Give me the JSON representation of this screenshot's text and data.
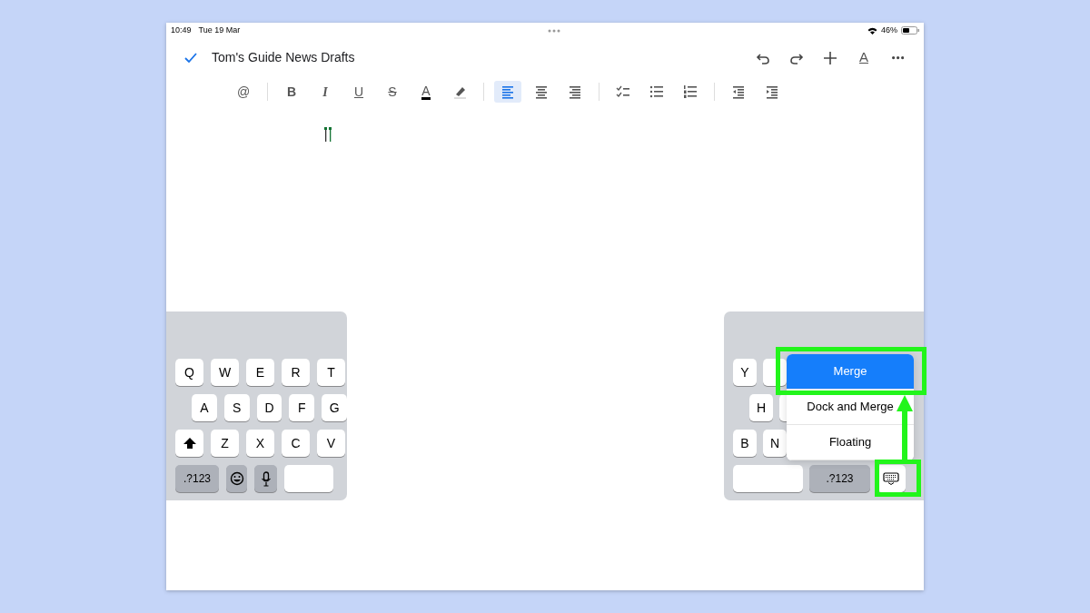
{
  "status_bar": {
    "time": "10:49",
    "date": "Tue 19 Mar",
    "battery": "46%"
  },
  "document": {
    "title": "Tom's Guide News Drafts"
  },
  "top_actions": [
    {
      "kind": "undo"
    },
    {
      "kind": "redo"
    },
    {
      "kind": "insert"
    },
    {
      "kind": "format",
      "glyph": "A"
    },
    {
      "kind": "more"
    }
  ],
  "format_toolbar": {
    "groups": [
      [
        {
          "glyph": "@",
          "selected": false
        }
      ],
      [
        {
          "glyph": "B",
          "selected": false
        },
        {
          "glyph": "I",
          "selected": false
        },
        {
          "glyph": "U",
          "selected": false
        },
        {
          "glyph": "S",
          "selected": false
        },
        {
          "glyph": "A",
          "selected": false
        },
        {
          "selected": false
        }
      ],
      [
        {
          "selected": true
        },
        {
          "selected": false
        },
        {
          "selected": false
        }
      ],
      [
        {
          "selected": false
        },
        {
          "selected": false
        },
        {
          "selected": false
        }
      ],
      [
        {
          "selected": false
        },
        {
          "selected": false
        }
      ]
    ]
  },
  "keyboard_left": {
    "rows": [
      [
        {
          "kind": "letter",
          "label": "Q"
        },
        {
          "kind": "letter",
          "label": "W"
        },
        {
          "kind": "letter",
          "label": "E"
        },
        {
          "kind": "letter",
          "label": "R"
        },
        {
          "kind": "letter",
          "label": "T"
        }
      ],
      [
        {
          "kind": "letter",
          "label": "A"
        },
        {
          "kind": "letter",
          "label": "S"
        },
        {
          "kind": "letter",
          "label": "D"
        },
        {
          "kind": "letter",
          "label": "F"
        },
        {
          "kind": "letter",
          "label": "G"
        }
      ],
      [
        {
          "kind": "shift"
        },
        {
          "kind": "letter",
          "label": "Z"
        },
        {
          "kind": "letter",
          "label": "X"
        },
        {
          "kind": "letter",
          "label": "C"
        },
        {
          "kind": "letter",
          "label": "V"
        }
      ],
      [
        {
          "kind": "mode",
          "label": ".?123"
        },
        {
          "kind": "emoji"
        },
        {
          "kind": "mic"
        },
        {
          "kind": "space"
        }
      ]
    ]
  },
  "keyboard_right": {
    "rows": [
      [
        {
          "kind": "letter",
          "label": "Y"
        },
        {
          "kind": "hidden"
        }
      ],
      [
        {
          "kind": "letter",
          "label": "H"
        },
        {
          "kind": "hidden"
        }
      ],
      [
        {
          "kind": "letter",
          "label": "B"
        },
        {
          "kind": "letter",
          "label": "N"
        }
      ],
      [
        {
          "kind": "space"
        },
        {
          "kind": "mode",
          "label": ".?123"
        },
        {
          "kind": "keyboard"
        }
      ]
    ]
  },
  "keyboard_menu": [
    {
      "label": "Merge",
      "selected": true
    },
    {
      "label": "Dock and Merge",
      "selected": false
    },
    {
      "label": "Floating",
      "selected": false
    }
  ]
}
